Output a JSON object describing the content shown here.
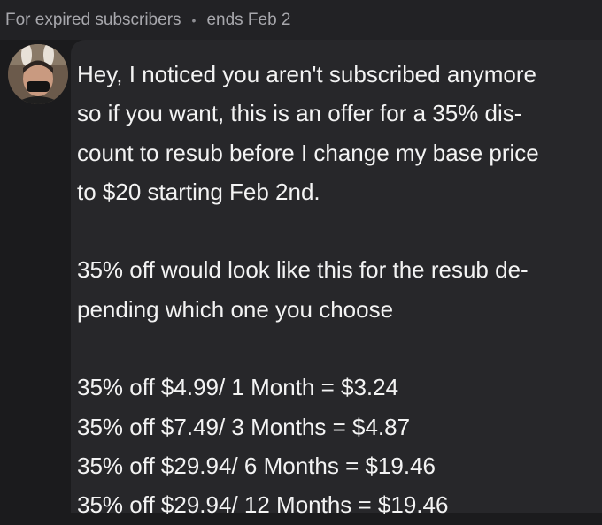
{
  "header": {
    "audience": "For expired subscribers",
    "separator": "•",
    "expiry": "ends Feb 2"
  },
  "sender": {
    "avatar_icon": "user-avatar-icon"
  },
  "message": {
    "paragraph1": [
      "Hey, I noticed you aren't subscribed anymore",
      "so if you want, this is an offer for a 35% dis-",
      "count to resub before I change my base price",
      "to $20 starting Feb 2nd."
    ],
    "paragraph2": [
      "35% off would look like this for the resub de-",
      "pending which one you choose"
    ],
    "price_list": [
      "35% off $4.99/ 1 Month = $3.24",
      "35% off $7.49/ 3 Months = $4.87",
      "35% off $29.94/ 6 Months = $19.46",
      "35% off $29.94/ 12 Months = $19.46"
    ]
  },
  "colors": {
    "background": "#1b1b1d",
    "header_background": "#222225",
    "bubble_background": "#27272a",
    "header_text": "#a8a8ad",
    "message_text": "#f3f3f3"
  }
}
